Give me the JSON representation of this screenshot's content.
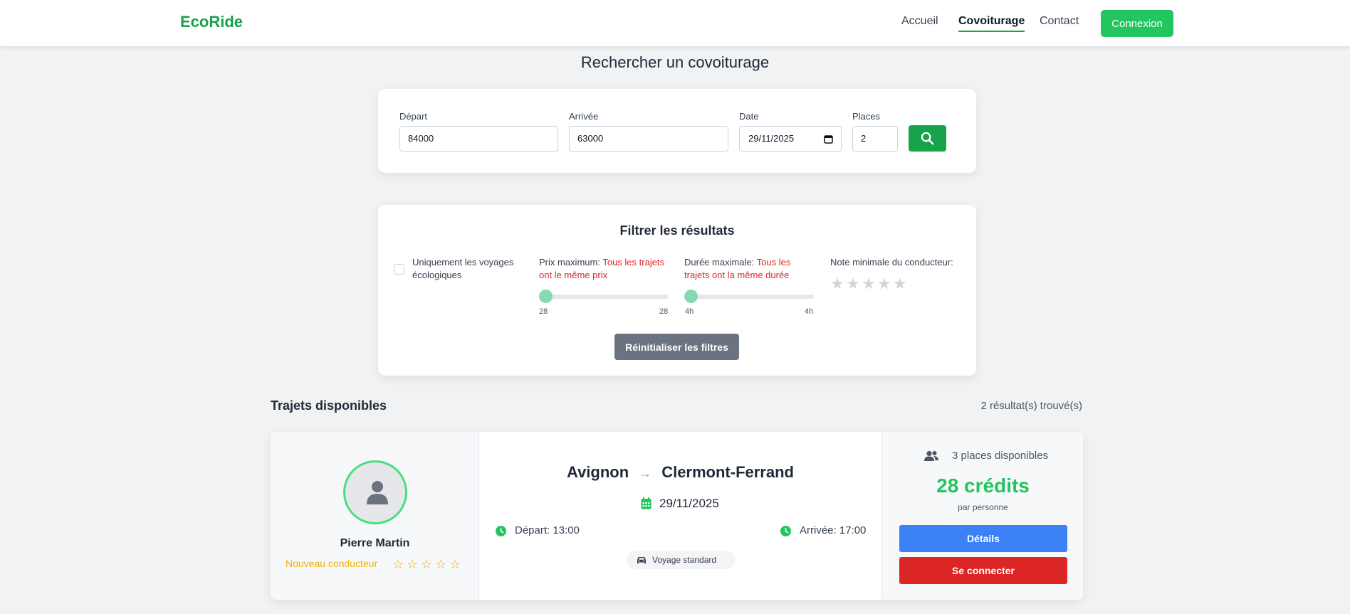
{
  "nav": {
    "brand": "EcoRide",
    "links": [
      "Accueil",
      "Covoiturage",
      "Contact"
    ],
    "active": "Covoiturage",
    "login_label": "Connexion"
  },
  "page_title": "Rechercher un covoiturage",
  "search": {
    "depart_label": "Départ",
    "depart_value": "84000",
    "arrivee_label": "Arrivée",
    "arrivee_value": "63000",
    "date_label": "Date",
    "date_value": "29/11/2025",
    "places_label": "Places",
    "places_value": "2"
  },
  "filters": {
    "title": "Filtrer les résultats",
    "eco_label": "Uniquement les voyages écologiques",
    "price_label": "Prix maximum:",
    "price_note": "Tous les trajets ont le même prix",
    "price_min": "28",
    "price_max": "28",
    "duration_label": "Durée maximale:",
    "duration_note": "Tous les trajets ont la même durée",
    "duration_min": "4h",
    "duration_max": "4h",
    "rating_label": "Note minimale du conducteur:",
    "reset_label": "Réinitialiser les filtres"
  },
  "results": {
    "title": "Trajets disponibles",
    "count": "2 résultat(s) trouvé(s)"
  },
  "ride": {
    "driver_name": "Pierre Martin",
    "driver_status": "Nouveau conducteur",
    "from": "Avignon",
    "to": "Clermont-Ferrand",
    "date": "29/11/2025",
    "depart_time": "Départ: 13:00",
    "arrival_time": "Arrivée: 17:00",
    "badge": "Voyage standard",
    "places": "3 places disponibles",
    "price": "28 crédits",
    "per_person": "par personne",
    "details_label": "Détails",
    "connect_label": "Se connecter"
  },
  "colors": {
    "brand_green": "#16a34a",
    "accent_green": "#22c55e",
    "blue": "#3b82f6",
    "red": "#dc2626"
  }
}
